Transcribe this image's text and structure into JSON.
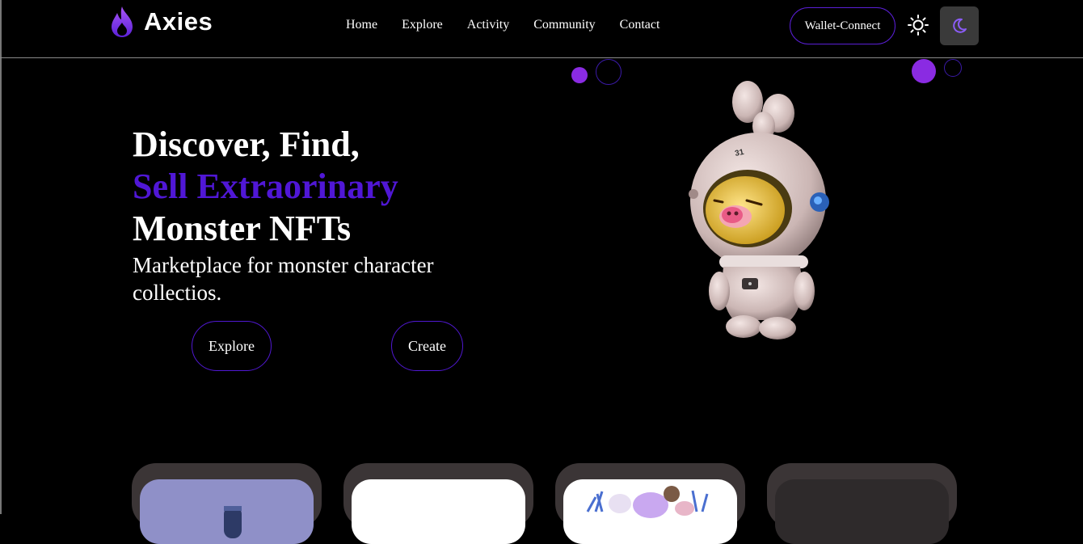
{
  "header": {
    "brand": "Axies",
    "nav": [
      "Home",
      "Explore",
      "Activity",
      "Community",
      "Contact"
    ],
    "wallet_label": "Wallet-Connect",
    "theme_icons": {
      "light": "sun-icon",
      "dark": "moon-icon"
    }
  },
  "hero": {
    "title_line1": "Discover, Find,",
    "title_line2": "Sell Extraorinary",
    "title_line3": "Monster NFTs",
    "subtitle": "Marketplace for monster character collectios.",
    "explore_label": "Explore",
    "create_label": "Create"
  },
  "colors": {
    "accent": "#5017d6",
    "dots": "#8a2be2",
    "card_bg": "#3b3536",
    "dark_button": "#3a3a3a"
  }
}
